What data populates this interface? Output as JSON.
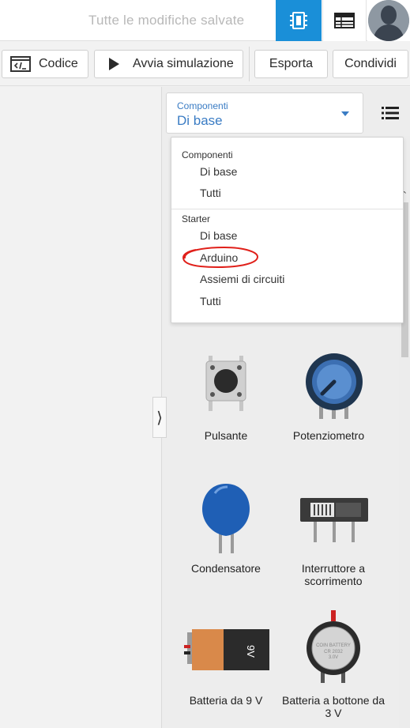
{
  "header": {
    "save_status": "Tutte le modifiche salvate",
    "circuit_view_icon": "circuit-chip-icon",
    "table_view_icon": "table-icon",
    "avatar_icon": "user-avatar-icon",
    "accent_color": "#1a8fd8"
  },
  "toolbar": {
    "code_label": "Codice",
    "simulate_label": "Avvia simulazione",
    "export_label": "Esporta",
    "share_label": "Condividi"
  },
  "panel": {
    "select": {
      "label": "Componenti",
      "value": "Di base"
    },
    "menu": {
      "groups": [
        {
          "title": "Componenti",
          "items": [
            "Di base",
            "Tutti"
          ]
        },
        {
          "title": "Starter",
          "items": [
            "Di base",
            "Arduino",
            "Assiemi di circuiti",
            "Tutti"
          ]
        }
      ],
      "highlighted_item": "Arduino"
    },
    "components": [
      {
        "label": "Pulsante"
      },
      {
        "label": "Potenziometro"
      },
      {
        "label": "Condensatore"
      },
      {
        "label": "Interruttore a scorrimento"
      },
      {
        "label": "Batteria da 9 V"
      },
      {
        "label": "Batteria a bottone da 3 V"
      }
    ],
    "battery_9v_marking": "9V",
    "coin_battery_marking": [
      "COIN BATTERY",
      "CR 2032",
      "3.0V"
    ]
  }
}
